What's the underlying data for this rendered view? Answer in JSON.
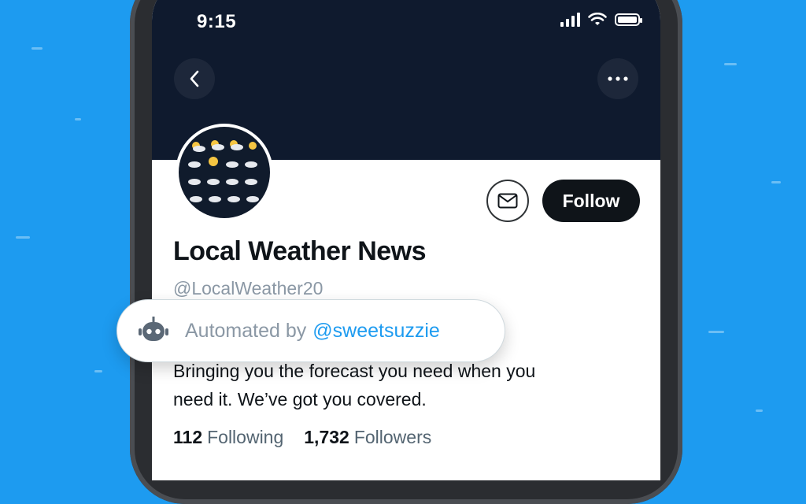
{
  "status_bar": {
    "time": "9:15"
  },
  "profile": {
    "display_name": "Local Weather News",
    "handle": "@LocalWeather20",
    "bio_line1": "Bringing you the forecast you need when you",
    "bio_line2": "need it.  We’ve got you covered.",
    "following_count": "112",
    "following_label": "Following",
    "followers_count": "1,732",
    "followers_label": "Followers"
  },
  "actions": {
    "follow_label": "Follow"
  },
  "automated_label": {
    "prefix": "Automated by",
    "account": "@sweetsuzzie"
  },
  "colors": {
    "background": "#1d9bf0",
    "banner": "#0f1a2e",
    "follow_button": "#0f1419",
    "link": "#1d9bf0"
  },
  "icons": [
    "back-arrow-icon",
    "more-icon",
    "mail-icon",
    "robot-icon",
    "wifi-icon",
    "signal-icon",
    "battery-icon"
  ]
}
